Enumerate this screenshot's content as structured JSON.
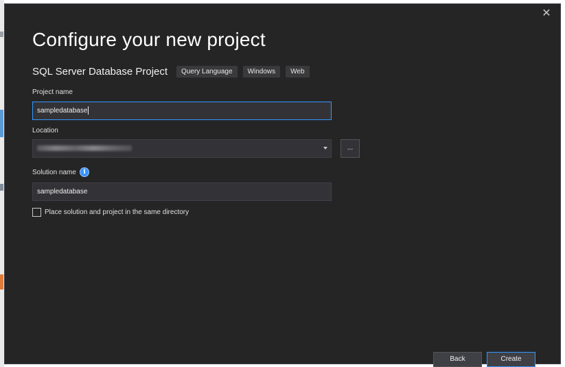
{
  "dialog": {
    "title": "Configure your new project",
    "close_icon": "close-icon"
  },
  "template": {
    "name": "SQL Server Database Project",
    "tags": [
      "Query Language",
      "Windows",
      "Web"
    ]
  },
  "project_name": {
    "label": "Project name",
    "value": "sampledatabase"
  },
  "location": {
    "label": "Location",
    "browse_label": "..."
  },
  "solution_name": {
    "label": "Solution name",
    "info_icon": "info-icon",
    "info_glyph": "i",
    "value": "sampledatabase"
  },
  "same_directory": {
    "label": "Place solution and project in the same directory",
    "checked": false
  },
  "footer": {
    "back_label": "Back",
    "create_label": "Create"
  },
  "colors": {
    "dialog_background": "#252526",
    "field_background": "#333337",
    "focus_border": "#3399ff",
    "text": "#f1f1f1"
  }
}
